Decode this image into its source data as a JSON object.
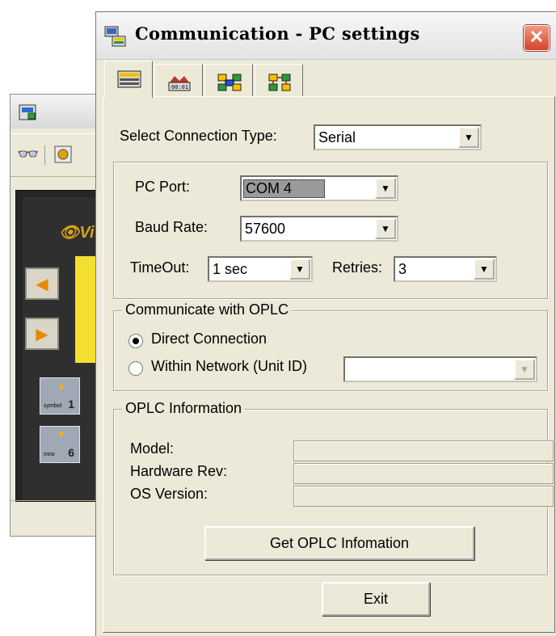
{
  "background_window": {
    "logo_text": "Vi",
    "keys": [
      {
        "label": "symbol",
        "number": "1"
      },
      {
        "label": "mno",
        "number": "6"
      }
    ]
  },
  "dialog": {
    "title": "Communication - PC settings",
    "close_glyph": "✕",
    "tabs": [
      "connection-tab-icon",
      "plc-tab-icon",
      "network-tab-icon",
      "modem-tab-icon"
    ],
    "connection_type": {
      "label": "Select Connection Type:",
      "value": "Serial"
    },
    "pc_port": {
      "label": "PC Port:",
      "value": "COM 4"
    },
    "baud_rate": {
      "label": "Baud Rate:",
      "value": "57600"
    },
    "timeout": {
      "label": "TimeOut:",
      "value": "1 sec"
    },
    "retries": {
      "label": "Retries:",
      "value": "3"
    },
    "communicate_group": {
      "title": "Communicate with OPLC",
      "direct_label": "Direct Connection",
      "network_label": "Within Network (Unit ID)",
      "unit_id": "",
      "selected": "direct"
    },
    "info_group": {
      "title": "OPLC Information",
      "model_label": "Model:",
      "hardware_label": "Hardware Rev:",
      "os_label": "OS Version:",
      "model_value": "",
      "hardware_value": "",
      "os_value": ""
    },
    "get_info_button": "Get OPLC Infomation",
    "exit_button": "Exit"
  },
  "colors": {
    "dialog_bg": "#ece9d8",
    "close_button": "#d1432a",
    "selection_gray": "#9a9a9a"
  }
}
